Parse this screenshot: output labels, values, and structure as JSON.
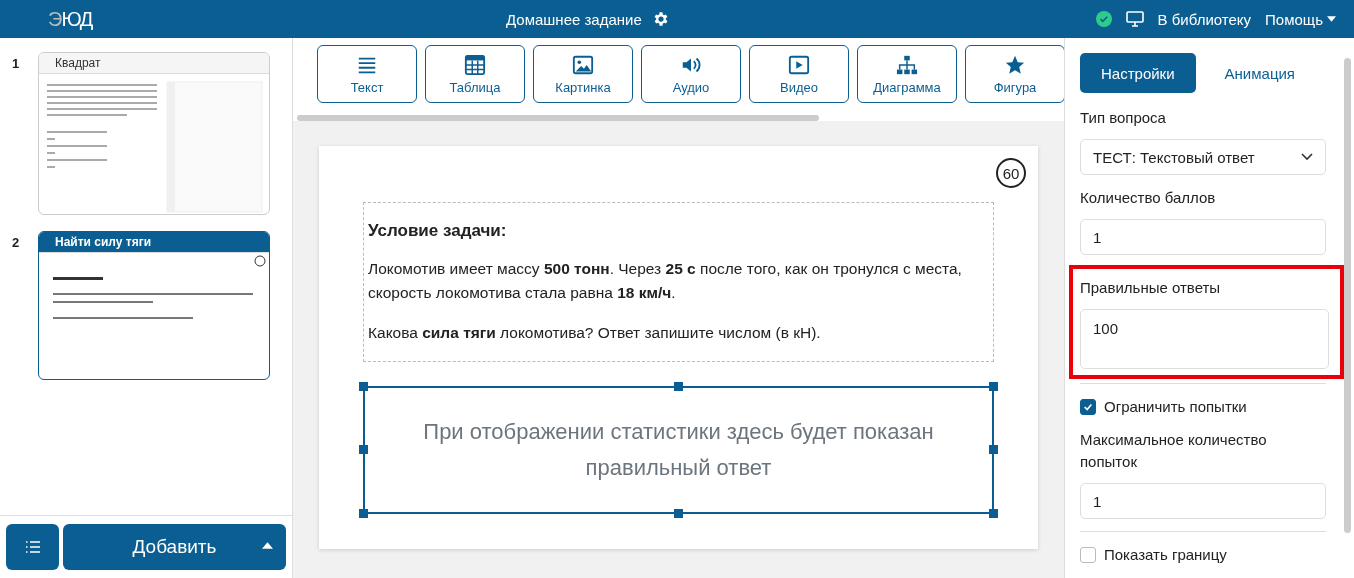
{
  "header": {
    "logo": "ЭЮД",
    "title": "Домашнее задание",
    "saved": true,
    "library_link": "В библиотеку",
    "help_menu": "Помощь"
  },
  "slides": [
    {
      "number": "1",
      "title": "Квадрат",
      "selected": false,
      "kind": "code"
    },
    {
      "number": "2",
      "title": "Найти силу тяги",
      "selected": true,
      "kind": "text"
    }
  ],
  "sidebar_footer": {
    "add_button": "Добавить"
  },
  "toolbar": [
    {
      "kind": "text",
      "label": "Текст"
    },
    {
      "kind": "table",
      "label": "Таблица"
    },
    {
      "kind": "image",
      "label": "Картинка"
    },
    {
      "kind": "audio",
      "label": "Аудио"
    },
    {
      "kind": "video",
      "label": "Видео"
    },
    {
      "kind": "diagram",
      "label": "Диаграмма"
    },
    {
      "kind": "shape",
      "label": "Фигура"
    }
  ],
  "slide": {
    "timer": "60",
    "heading": "Условие задачи:",
    "paragraphs": [
      "Локомотив имеет массу **500 тонн**. Через **25 с** после того, как он тронулся с места, скорость локомотива стала равна **18 км/ч**.",
      "Какова **сила тяги** локомотива? Ответ запишите числом (в кН)."
    ],
    "answer_placeholder": "При отображении статистики здесь будет показан правильный ответ",
    "answer_selected": true
  },
  "panel": {
    "tabs": [
      {
        "label": "Настройки",
        "selected": true
      },
      {
        "label": "Анимация",
        "selected": false
      }
    ],
    "fields": [
      {
        "kind": "select",
        "label": "Тип вопроса",
        "value": "ТЕСТ: Текстовый ответ",
        "highlighted": false
      },
      {
        "kind": "input",
        "label": "Количество баллов",
        "value": "1",
        "highlighted": false
      },
      {
        "kind": "textarea",
        "label": "Правильные ответы",
        "value": "100",
        "highlighted": true
      },
      {
        "kind": "divider"
      },
      {
        "kind": "checkbox",
        "label": "Ограничить попытки",
        "checked": true
      },
      {
        "kind": "input",
        "label": "Максимальное количество попыток",
        "value": "1",
        "highlighted": false
      },
      {
        "kind": "divider"
      },
      {
        "kind": "checkbox",
        "label": "Показать границу",
        "checked": false
      }
    ]
  }
}
